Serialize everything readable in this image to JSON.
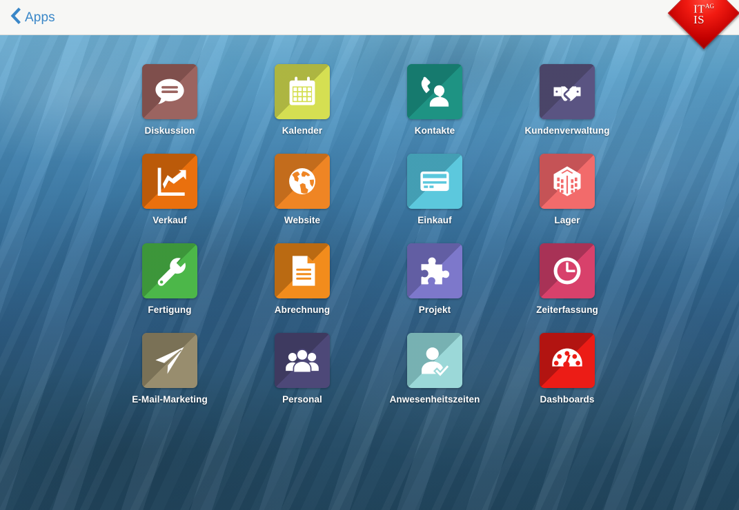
{
  "topbar": {
    "back_label": "Apps",
    "back_icon": "chevron-left-icon",
    "accent_color": "#3a87c8",
    "background_color": "#f7f7f5"
  },
  "logo": {
    "line1": "IT",
    "line2": "IS",
    "superscript": "AG",
    "shape": "diamond",
    "color": "#e81b10"
  },
  "wallpaper": {
    "style": "painted-blue-gradient",
    "top_color": "#6aaed4",
    "bottom_color": "#234861"
  },
  "apps": [
    {
      "label": "Diskussion",
      "icon": "speech-bubble-icon",
      "tile_color": "#9b6460",
      "shadow_color": "#7a4b48"
    },
    {
      "label": "Kalender",
      "icon": "calendar-icon",
      "tile_color": "#d5df52",
      "shadow_color": "#a6ae3e"
    },
    {
      "label": "Kontakte",
      "icon": "phone-contact-icon",
      "tile_color": "#1e9383",
      "shadow_color": "#14756a"
    },
    {
      "label": "Kundenverwaltung",
      "icon": "handshake-icon",
      "tile_color": "#5a5482",
      "shadow_color": "#474264"
    },
    {
      "label": "Verkauf",
      "icon": "growth-chart-icon",
      "tile_color": "#ea700d",
      "shadow_color": "#b35608"
    },
    {
      "label": "Website",
      "icon": "globe-icon",
      "tile_color": "#ef8524",
      "shadow_color": "#bb671a"
    },
    {
      "label": "Einkauf",
      "icon": "credit-card-icon",
      "tile_color": "#5cc8dd",
      "shadow_color": "#3f97ac"
    },
    {
      "label": "Lager",
      "icon": "warehouse-box-icon",
      "tile_color": "#f26b6b",
      "shadow_color": "#bd4f52"
    },
    {
      "label": "Fertigung",
      "icon": "wrench-icon",
      "tile_color": "#4cb749",
      "shadow_color": "#3a9038"
    },
    {
      "label": "Abrechnung",
      "icon": "invoice-document-icon",
      "tile_color": "#f28c1c",
      "shadow_color": "#b06410"
    },
    {
      "label": "Projekt",
      "icon": "puzzle-piece-icon",
      "tile_color": "#7d78cb",
      "shadow_color": "#5d599c"
    },
    {
      "label": "Zeiterfassung",
      "icon": "clock-icon",
      "tile_color": "#d8416b",
      "shadow_color": "#a02f52"
    },
    {
      "label": "E-Mail-Marketing",
      "icon": "paper-plane-icon",
      "tile_color": "#988d6e",
      "shadow_color": "#756c52"
    },
    {
      "label": "Personal",
      "icon": "people-group-icon",
      "tile_color": "#4d4878",
      "shadow_color": "#3b375c"
    },
    {
      "label": "Anwesenheitszeiten",
      "icon": "person-check-icon",
      "tile_color": "#9bd8d8",
      "shadow_color": "#71aaab"
    },
    {
      "label": "Dashboards",
      "icon": "gauge-icon",
      "tile_color": "#ec1c16",
      "shadow_color": "#a81310"
    }
  ]
}
